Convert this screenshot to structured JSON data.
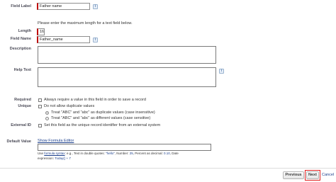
{
  "form": {
    "field_label": {
      "label": "Field Label",
      "value": "Father name"
    },
    "length_hint": "Please enter the maximum length for a text field below.",
    "length": {
      "label": "Length",
      "value": "16"
    },
    "field_name": {
      "label": "Field Name",
      "value": "Father_name"
    },
    "description": {
      "label": "Description"
    },
    "help_text": {
      "label": "Help Text"
    },
    "required": {
      "label": "Required",
      "text": "Always require a value in this field in order to save a record"
    },
    "unique": {
      "label": "Unique",
      "text": "Do not allow duplicate values",
      "options": [
        "Treat \"ABC\" and \"abc\" as duplicate values (case insensitive)",
        "Treat \"ABC\" and \"abc\" as different values (case sensitive)"
      ]
    },
    "external_id": {
      "label": "External ID",
      "text": "Set this field as the unique record identifier from an external system"
    },
    "default_value": {
      "label": "Default Value",
      "link": "Show Formula Editor",
      "hint_use": "Use ",
      "hint_link": "formula syntax",
      "hint_mid": ": e.g., Text in double quotes: ",
      "hint_ex1": "\"hello\"",
      "hint_num": ", Number: ",
      "hint_ex2": "25",
      "hint_pct": ", Percent as decimal: ",
      "hint_ex3": "0.10",
      "hint_date": ", Date",
      "hint_line2": "expression: ",
      "hint_ex4": "Today() + 7"
    },
    "info_icon": "i"
  },
  "buttons": {
    "previous": "Previous",
    "next": "Next",
    "cancel": "Cancel"
  },
  "colors": {
    "required_bar": "#c00000",
    "link": "#1a3e8c",
    "highlight": "#e02020"
  }
}
